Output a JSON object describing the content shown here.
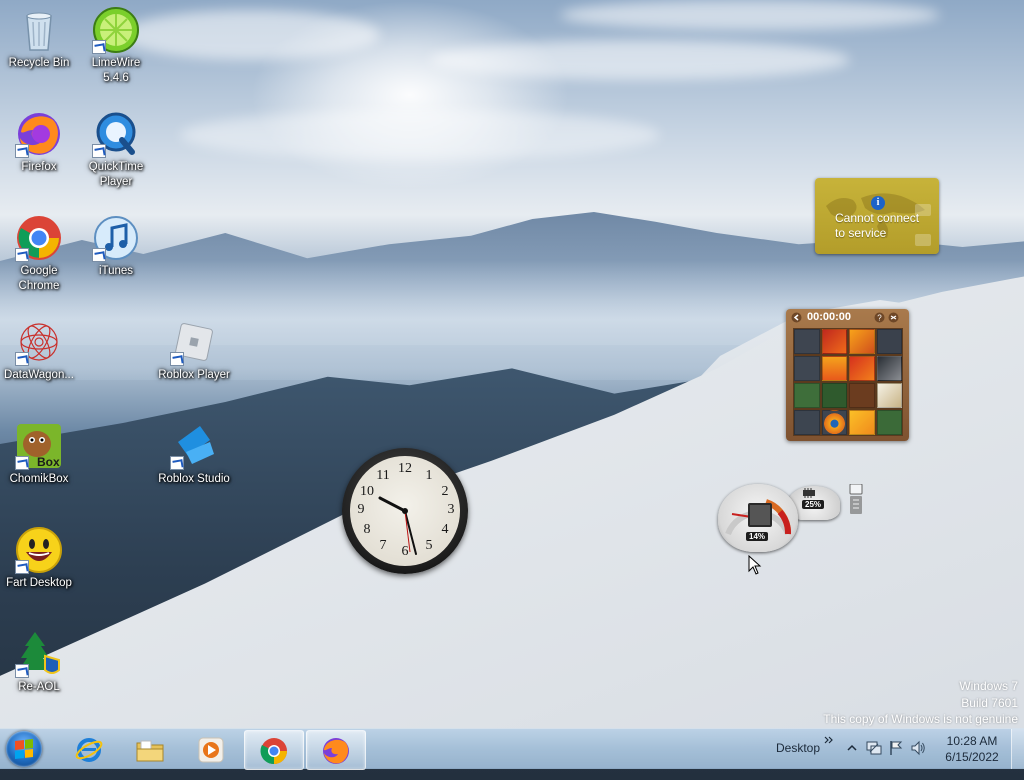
{
  "desktop_icons": [
    {
      "label": "Recycle Bin",
      "icon": "recycle-bin-icon"
    },
    {
      "label": "LimeWire 5.4.6",
      "icon": "limewire-icon"
    },
    {
      "label": "Firefox",
      "icon": "firefox-icon"
    },
    {
      "label": "QuickTime Player",
      "icon": "quicktime-icon"
    },
    {
      "label": "Google Chrome",
      "icon": "chrome-icon"
    },
    {
      "label": "iTunes",
      "icon": "itunes-icon"
    },
    {
      "label": "DataWagon...",
      "icon": "datawagon-icon"
    },
    {
      "label": "Roblox Player",
      "icon": "roblox-player-icon"
    },
    {
      "label": "ChomikBox",
      "icon": "chomikbox-icon"
    },
    {
      "label": "Roblox Studio",
      "icon": "roblox-studio-icon"
    },
    {
      "label": "Fart Desktop",
      "icon": "fart-desktop-icon"
    },
    {
      "label": "Re-AOL",
      "icon": "re-aol-icon"
    }
  ],
  "weather_gadget": {
    "message": "Cannot connect to service",
    "accent": "#c2ad35"
  },
  "puzzle_gadget": {
    "timer": "00:00:00"
  },
  "clock_gadget": {
    "numbers": [
      "12",
      "1",
      "2",
      "3",
      "4",
      "5",
      "6",
      "7",
      "8",
      "9",
      "10",
      "11"
    ],
    "time": "10:28"
  },
  "cpu_meter": {
    "cpu_percent": "14%",
    "memory_percent": "25%"
  },
  "watermark": {
    "line1": "Windows 7",
    "line2": "Build 7601",
    "line3": "This copy of Windows is not genuine"
  },
  "taskbar": {
    "pinned": [
      {
        "icon": "internet-explorer-icon",
        "active": false
      },
      {
        "icon": "windows-explorer-icon",
        "active": false
      },
      {
        "icon": "media-player-icon",
        "active": false
      },
      {
        "icon": "chrome-icon",
        "active": true
      },
      {
        "icon": "firefox-icon",
        "active": true
      }
    ],
    "desktop_label": "Desktop",
    "time": "10:28 AM",
    "date": "6/15/2022"
  }
}
